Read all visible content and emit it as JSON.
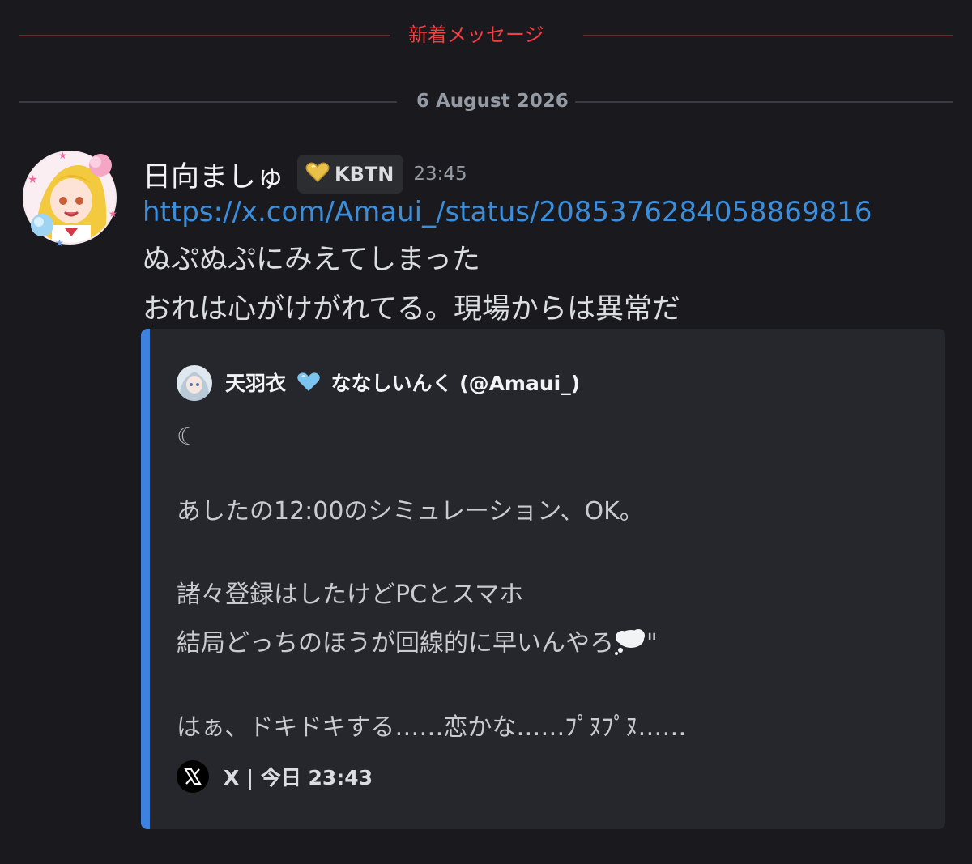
{
  "new_messages_divider": {
    "label": "新着メッセージ"
  },
  "date_divider": {
    "label": "6 August 2026"
  },
  "message": {
    "author": "日向ましゅ",
    "tag": {
      "icon": "gold-heart-icon",
      "label": "KBTN"
    },
    "timestamp": "23:45",
    "link": "https://x.com/Amaui_/status/2085376284058869816",
    "lines": [
      "ぬぷぬぷにみえてしまった",
      "おれは心がけがれてる。現場からは異常だ"
    ]
  },
  "embed": {
    "accent_color": "#3d82de",
    "author_name_pre": "天羽衣",
    "author_heart_icon": "light-blue-heart-icon",
    "author_name_post": "ななしいんく (@Amaui_)",
    "moon": "☾",
    "lines": [
      "あしたの12:00のシミュレーション、OK。",
      "諸々登録はしたけどPCとスマホ",
      "結局どっちのほうが回線的に早いんやろ",
      "はぁ、ドキドキする……恋かな……ﾌﾟﾇﾌﾟﾇ……"
    ],
    "line3_suffix": "\"",
    "footer": {
      "icon": "x-logo-icon",
      "text": "X | 今日 23:43"
    }
  },
  "colors": {
    "background": "#1a1a1e",
    "new_divider": "#f23f42",
    "link": "#3b8edb",
    "embed_bg": "#26272d"
  }
}
